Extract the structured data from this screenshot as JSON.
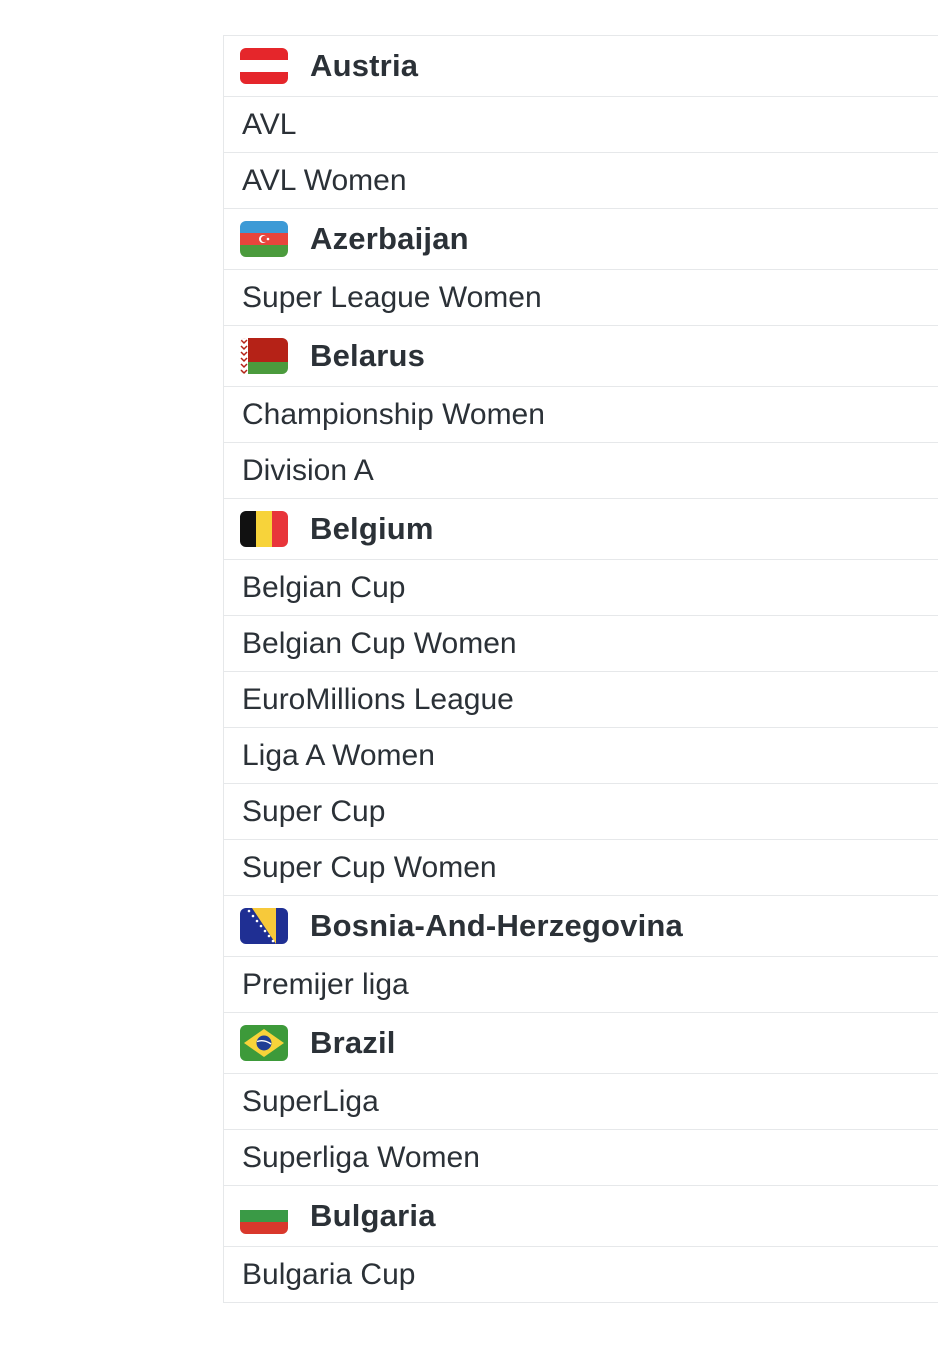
{
  "groups": [
    {
      "country": "Austria",
      "flag": "austria-flag-icon",
      "leagues": [
        "AVL",
        "AVL Women"
      ]
    },
    {
      "country": "Azerbaijan",
      "flag": "azerbaijan-flag-icon",
      "leagues": [
        "Super League Women"
      ]
    },
    {
      "country": "Belarus",
      "flag": "belarus-flag-icon",
      "leagues": [
        "Championship Women",
        "Division A"
      ]
    },
    {
      "country": "Belgium",
      "flag": "belgium-flag-icon",
      "leagues": [
        "Belgian Cup",
        "Belgian Cup Women",
        "EuroMillions League",
        "Liga A Women",
        "Super Cup",
        "Super Cup Women"
      ]
    },
    {
      "country": "Bosnia-And-Herzegovina",
      "flag": "bosnia-flag-icon",
      "leagues": [
        "Premijer liga"
      ]
    },
    {
      "country": "Brazil",
      "flag": "brazil-flag-icon",
      "leagues": [
        "SuperLiga",
        "Superliga Women"
      ]
    },
    {
      "country": "Bulgaria",
      "flag": "bulgaria-flag-icon",
      "leagues": [
        "Bulgaria Cup"
      ]
    }
  ],
  "colors": {
    "text": "#2b3137",
    "divider": "#e6e8ea"
  }
}
